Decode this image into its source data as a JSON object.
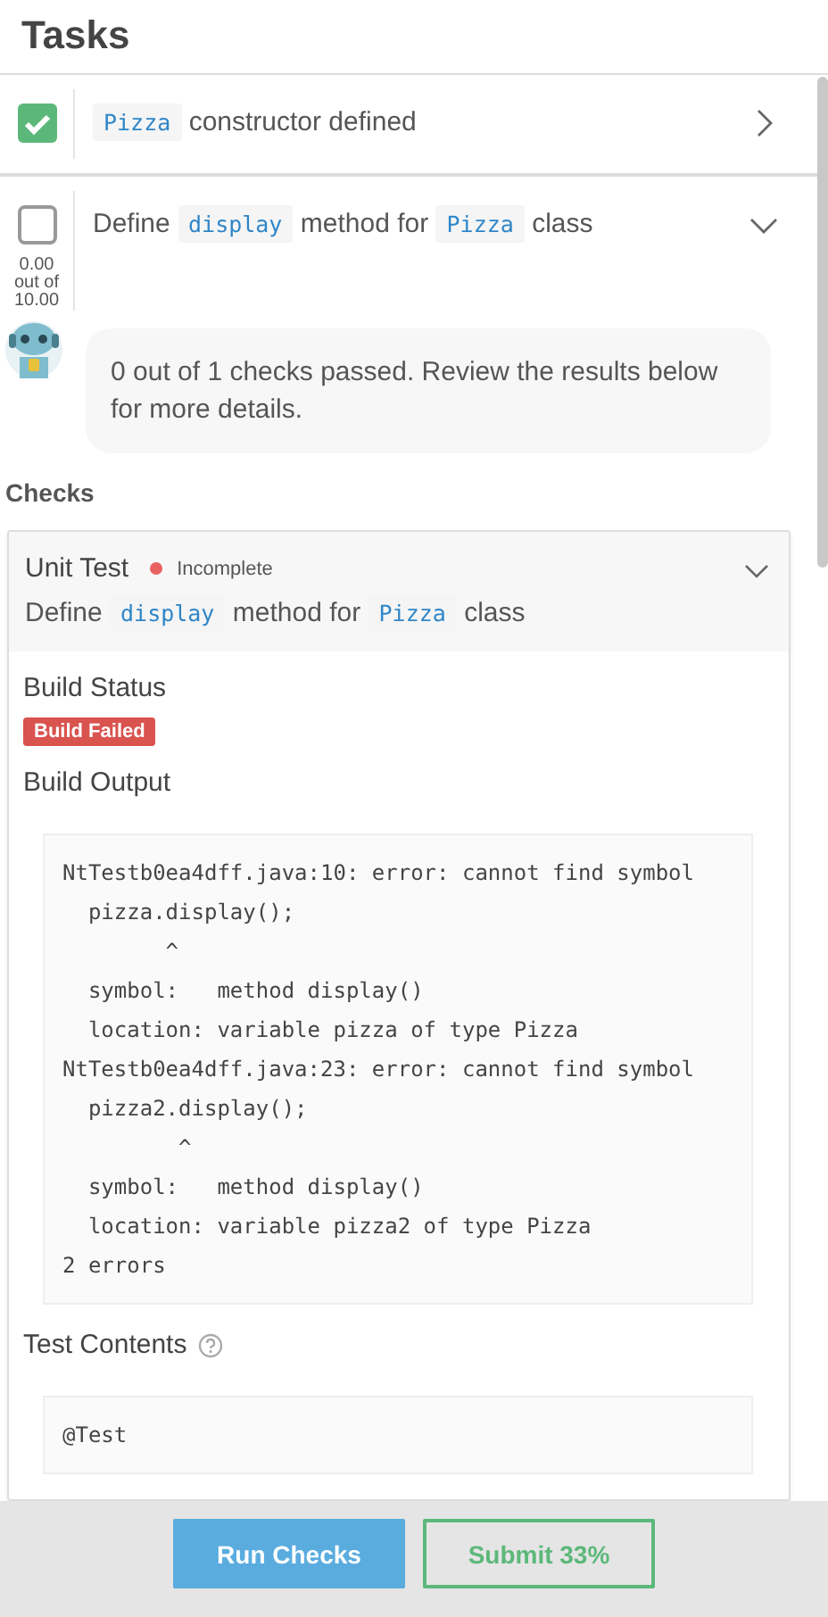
{
  "header": {
    "title": "Tasks"
  },
  "tasks": [
    {
      "checked": true,
      "expanded": false,
      "title": [
        {
          "kind": "code",
          "text": "Pizza"
        },
        {
          "kind": "text",
          "text": "constructor defined"
        }
      ]
    },
    {
      "checked": false,
      "expanded": true,
      "score": "0.00 out of 10.00",
      "title": [
        {
          "kind": "text",
          "text": "Define"
        },
        {
          "kind": "code",
          "text": "display"
        },
        {
          "kind": "text",
          "text": "method for"
        },
        {
          "kind": "code",
          "text": "Pizza"
        },
        {
          "kind": "text",
          "text": "class"
        }
      ],
      "feedback": "0 out of 1 checks passed. Review the results below for more details."
    }
  ],
  "checks_heading": "Checks",
  "checks": [
    {
      "type_label": "Unit Test",
      "status": "Incomplete",
      "color": "#e86060",
      "expanded": true,
      "title": [
        {
          "kind": "text",
          "text": "Define"
        },
        {
          "kind": "code",
          "text": "display"
        },
        {
          "kind": "text",
          "text": "method for"
        },
        {
          "kind": "code",
          "text": "Pizza"
        },
        {
          "kind": "text",
          "text": "class"
        }
      ],
      "build_status_label": "Build Status",
      "build_badge": "Build Failed",
      "build_ok": false,
      "build_output_label": "Build Output",
      "build_output": "NtTestb0ea4dff.java:10: error: cannot find symbol\n  pizza.display();\n        ^\n  symbol:   method display()\n  location: variable pizza of type Pizza\nNtTestb0ea4dff.java:23: error: cannot find symbol\n  pizza2.display();\n         ^\n  symbol:   method display()\n  location: variable pizza2 of type Pizza\n2 errors",
      "test_contents_label": "Test Contents",
      "test_contents": "@Test"
    }
  ],
  "footer": {
    "buttons": [
      {
        "label": "Run Checks",
        "kind": "primary"
      },
      {
        "label": "Submit 33%",
        "kind": "outline"
      }
    ]
  }
}
